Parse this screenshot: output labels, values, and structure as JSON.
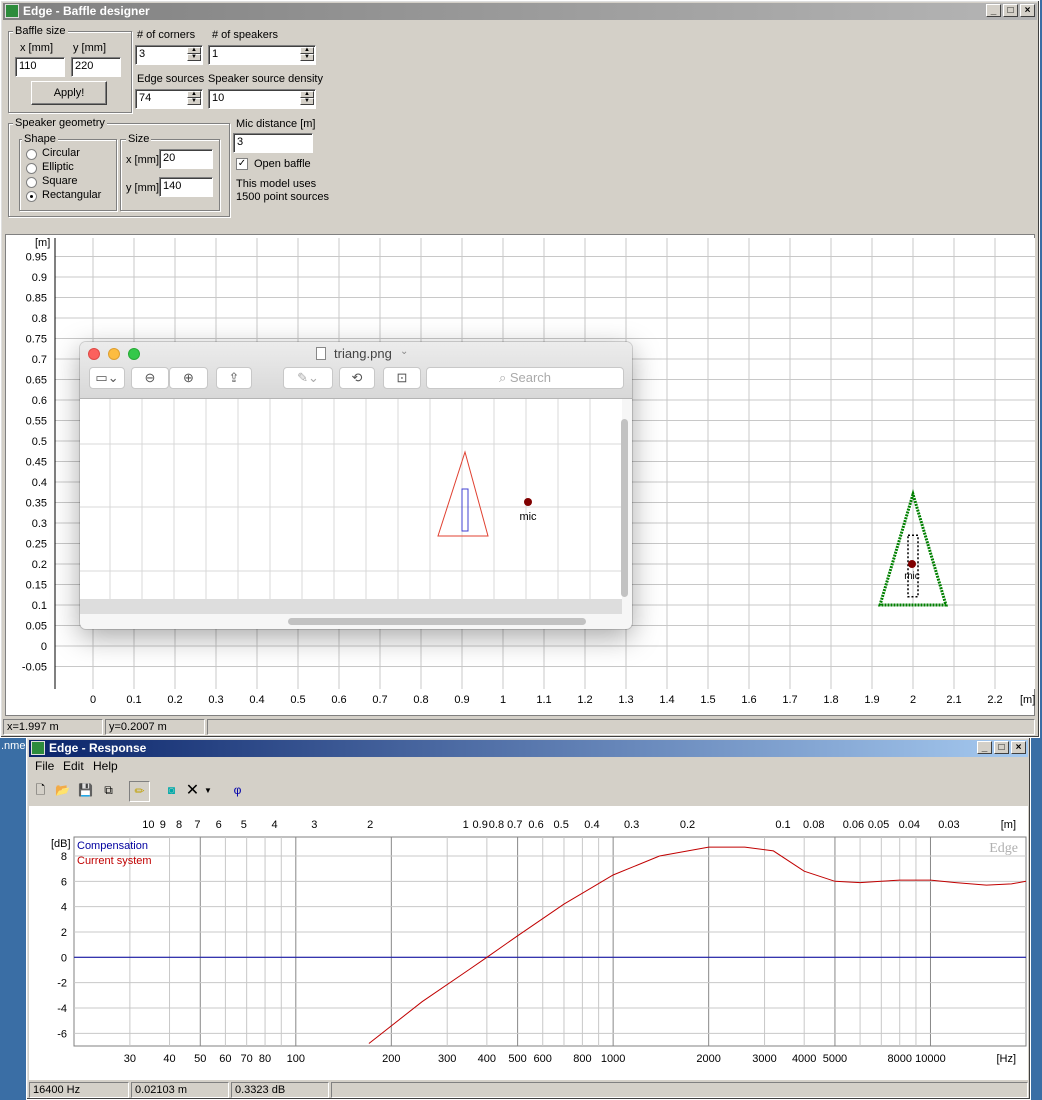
{
  "baffle": {
    "title": "Edge - Baffle designer",
    "baffle_size": {
      "label": "Baffle size",
      "x_label": "x [mm]",
      "y_label": "y [mm]",
      "x_value": "110",
      "y_value": "220",
      "apply": "Apply!"
    },
    "corners": {
      "label": "# of corners",
      "value": "3"
    },
    "speakers": {
      "label": "# of speakers",
      "value": "1"
    },
    "edge_sources": {
      "label": "Edge sources",
      "value": "74"
    },
    "speaker_density": {
      "label": "Speaker source density",
      "value": "10"
    },
    "geometry": {
      "label": "Speaker geometry",
      "shape_label": "Shape",
      "size_label": "Size",
      "shapes": [
        "Circular",
        "Elliptic",
        "Square",
        "Rectangular"
      ],
      "selected": 3,
      "x_label": "x [mm]",
      "x_value": "20",
      "y_label": "y [mm]",
      "y_value": "140"
    },
    "mic": {
      "label": "Mic distance [m]",
      "value": "3",
      "open_baffle": "Open baffle",
      "info1": "This model uses",
      "info2": "1500 point sources"
    },
    "plot": {
      "unit_y": "[m]",
      "unit_x": "[m]",
      "y_ticks": [
        "0.95",
        "0.9",
        "0.85",
        "0.8",
        "0.75",
        "0.7",
        "0.65",
        "0.6",
        "0.55",
        "0.5",
        "0.45",
        "0.4",
        "0.35",
        "0.3",
        "0.25",
        "0.2",
        "0.15",
        "0.1",
        "0.05",
        "0",
        "-0.05"
      ],
      "x_ticks": [
        "0",
        "0.1",
        "0.2",
        "0.3",
        "0.4",
        "0.5",
        "0.6",
        "0.7",
        "0.8",
        "0.9",
        "1",
        "1.1",
        "1.2",
        "1.3",
        "1.4",
        "1.5",
        "1.6",
        "1.7",
        "1.8",
        "1.9",
        "2",
        "2.1",
        "2.2"
      ],
      "mic_label": "mic",
      "baffle_color": "#008000"
    },
    "status": {
      "x": "x=1.997 m",
      "y": "y=0.2007 m"
    }
  },
  "preview": {
    "filename": "triang.png",
    "search_placeholder": "Search",
    "mic_label": "mic"
  },
  "response": {
    "title": "Edge - Response",
    "menu": [
      "File",
      "Edit",
      "Help"
    ],
    "left_label": ".nme",
    "chart_data": {
      "type": "line",
      "title": "",
      "ylabel": "[dB]",
      "watermark": "Edge",
      "x_scale": "log",
      "xlim": [
        20,
        20000
      ],
      "ylim": [
        -7,
        9.5
      ],
      "x_unit": "[Hz]",
      "top_unit": "[m]",
      "x_ticks": [
        "30",
        "40",
        "50",
        "60",
        "70",
        "80",
        "100",
        "200",
        "300",
        "400",
        "500",
        "600",
        "800",
        "1000",
        "2000",
        "3000",
        "4000",
        "5000",
        "8000",
        "10000"
      ],
      "y_ticks": [
        "8",
        "6",
        "4",
        "2",
        "0",
        "-2",
        "-4",
        "-6"
      ],
      "top_ticks": [
        "10",
        "9",
        "8",
        "7",
        "6",
        "5",
        "4",
        "3",
        "2",
        "1",
        "0.9",
        "0.8",
        "0.7",
        "0.6",
        "0.5",
        "0.4",
        "0.3",
        "0.2",
        "0.1",
        "0.08",
        "0.06",
        "0.05",
        "0.04",
        "0.03"
      ],
      "series": [
        {
          "name": "Compensation",
          "color": "#0000a0",
          "x": [
            20,
            20000
          ],
          "y": [
            0,
            0
          ]
        },
        {
          "name": "Current system",
          "color": "#c00000",
          "x": [
            170,
            250,
            350,
            400,
            500,
            700,
            1000,
            1400,
            2000,
            2600,
            3200,
            4000,
            5000,
            6000,
            7000,
            8000,
            10000,
            12000,
            15000,
            18000,
            20000
          ],
          "y": [
            -6.8,
            -3.5,
            -1.0,
            0.0,
            1.7,
            4.2,
            6.5,
            8.0,
            8.7,
            8.7,
            8.4,
            6.8,
            6.0,
            5.9,
            6.0,
            6.1,
            6.1,
            5.9,
            5.7,
            5.8,
            6.0
          ]
        }
      ]
    },
    "status": {
      "freq": "16400 Hz",
      "dist": "0.02103 m",
      "db": "0.3323 dB"
    }
  }
}
